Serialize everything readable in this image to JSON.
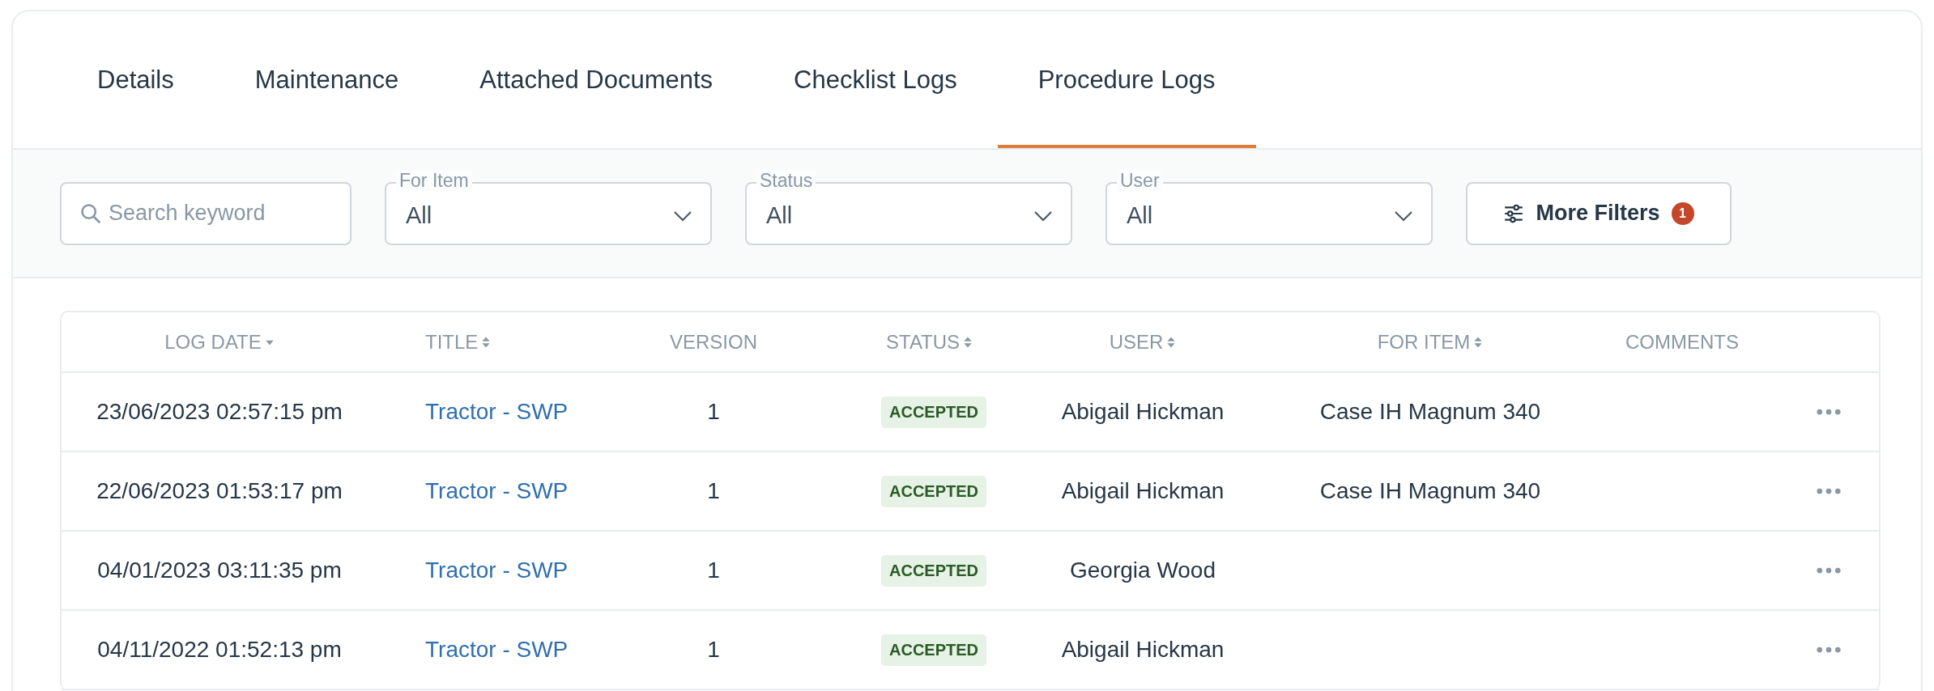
{
  "tabs": [
    {
      "label": "Details",
      "selected": false
    },
    {
      "label": "Maintenance",
      "selected": false
    },
    {
      "label": "Attached Documents",
      "selected": false
    },
    {
      "label": "Checklist Logs",
      "selected": false
    },
    {
      "label": "Procedure Logs",
      "selected": true
    }
  ],
  "filters": {
    "search": {
      "placeholder": "Search keyword"
    },
    "dropdowns": [
      {
        "label": "For Item",
        "value": "All"
      },
      {
        "label": "Status",
        "value": "All"
      },
      {
        "label": "User",
        "value": "All"
      }
    ],
    "more_filters": {
      "label": "More Filters",
      "count": "1"
    }
  },
  "table": {
    "columns": [
      {
        "label": "LOG DATE",
        "sorted": true
      },
      {
        "label": "TITLE",
        "sortable": true,
        "sorted": false
      },
      {
        "label": "VERSION",
        "sortable": false,
        "sorted": false
      },
      {
        "label": "STATUS",
        "sortable": true,
        "sorted": false
      },
      {
        "label": "USER",
        "sortable": true,
        "sorted": false
      },
      {
        "label": "FOR ITEM",
        "sortable": true,
        "sorted": false
      },
      {
        "label": "COMMENTS",
        "sortable": false,
        "sorted": false
      }
    ],
    "rows": [
      {
        "log_date": "23/06/2023 02:57:15 pm",
        "title": "Tractor - SWP",
        "version": "1",
        "status": "ACCEPTED",
        "user": "Abigail Hickman",
        "for_item": "Case IH Magnum 340"
      },
      {
        "log_date": "22/06/2023 01:53:17 pm",
        "title": "Tractor - SWP",
        "version": "1",
        "status": "ACCEPTED",
        "user": "Abigail Hickman",
        "for_item": "Case IH Magnum 340"
      },
      {
        "log_date": "04/01/2023 03:11:35 pm",
        "title": "Tractor - SWP",
        "version": "1",
        "status": "ACCEPTED",
        "user": "Georgia Wood"
      },
      {
        "log_date": "04/11/2022 01:52:13 pm",
        "title": "Tractor - SWP",
        "version": "1",
        "status": "ACCEPTED",
        "user": "Abigail Hickman"
      }
    ]
  }
}
